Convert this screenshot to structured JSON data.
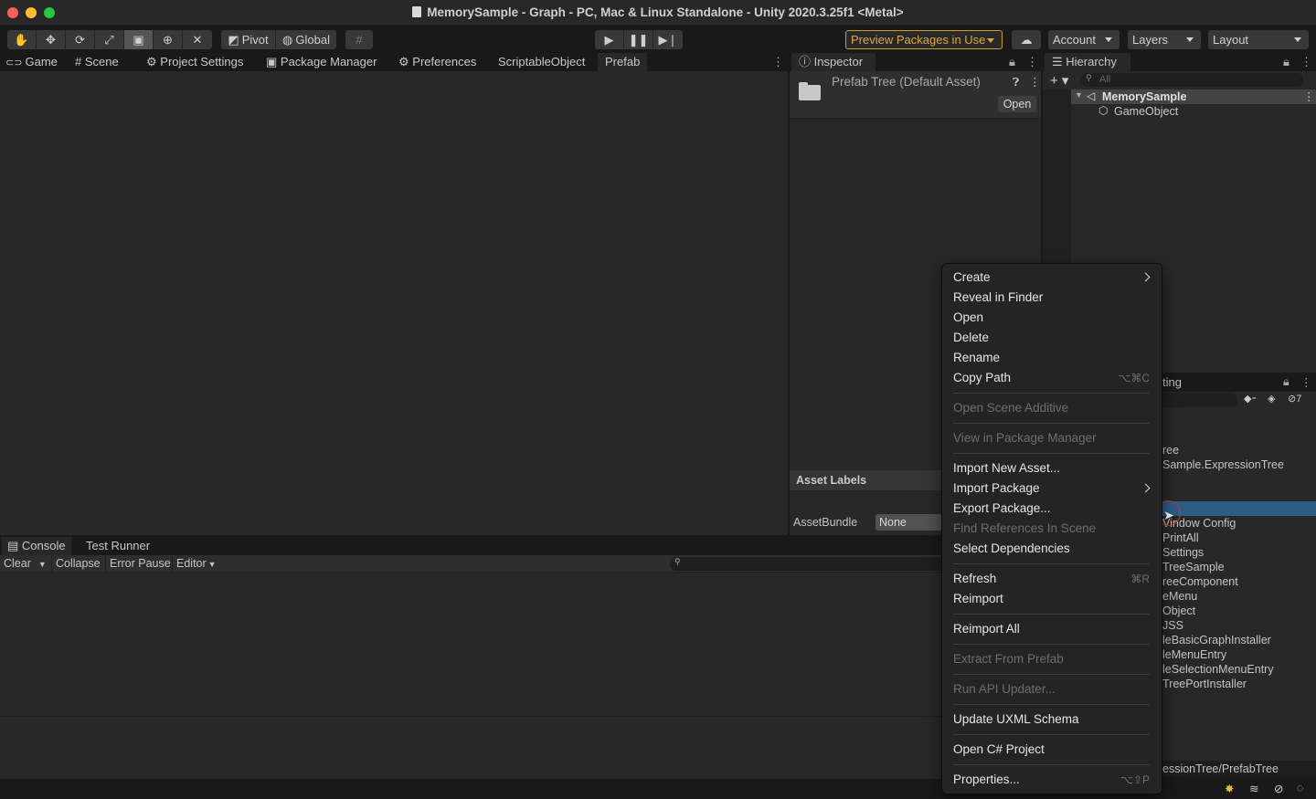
{
  "window": {
    "title": "MemorySample - Graph - PC, Mac & Linux Standalone - Unity 2020.3.25f1 <Metal>"
  },
  "toolbar": {
    "pivot_label": "Pivot",
    "global_label": "Global",
    "preview_packages_label": "Preview Packages in Use",
    "account_label": "Account",
    "layers_label": "Layers",
    "layout_label": "Layout"
  },
  "main_tabs": [
    "Game",
    "Scene",
    "Project Settings",
    "Package Manager",
    "Preferences",
    "ScriptableObject",
    "Prefab"
  ],
  "inspector": {
    "tab_label": "Inspector",
    "asset_title": "Prefab Tree (Default Asset)",
    "open_button": "Open",
    "asset_labels_header": "Asset Labels",
    "assetbundle_label": "AssetBundle",
    "assetbundle_value": "None"
  },
  "hierarchy": {
    "tab_label": "Hierarchy",
    "search_placeholder": "All",
    "scene_name": "MemorySample",
    "child_object": "GameObject"
  },
  "project_panel": {
    "tab_partial": "ting",
    "hidden_count": "7",
    "items": [
      "ree",
      "Sample.ExpressionTree",
      "",
      "Vindow Config",
      "PrintAll",
      "Settings",
      "TreeSample",
      "reeComponent",
      "eMenu",
      "Object",
      "JSS",
      "leBasicGraphInstaller",
      "leMenuEntry",
      "leSelectionMenuEntry",
      "TreePortInstaller"
    ],
    "path": "essionTree/PrefabTree"
  },
  "console": {
    "tabs": [
      "Console",
      "Test Runner"
    ],
    "clear_label": "Clear",
    "collapse_label": "Collapse",
    "error_pause_label": "Error Pause",
    "editor_label": "Editor"
  },
  "context_menu": {
    "create": "Create",
    "reveal_in_finder": "Reveal in Finder",
    "open": "Open",
    "delete": "Delete",
    "rename": "Rename",
    "copy_path": "Copy Path",
    "copy_path_shortcut": "⌥⌘C",
    "open_scene_additive": "Open Scene Additive",
    "view_in_package_manager": "View in Package Manager",
    "import_new_asset": "Import New Asset...",
    "import_package": "Import Package",
    "export_package": "Export Package...",
    "find_references": "Find References In Scene",
    "select_dependencies": "Select Dependencies",
    "refresh": "Refresh",
    "refresh_shortcut": "⌘R",
    "reimport": "Reimport",
    "reimport_all": "Reimport All",
    "extract_from_prefab": "Extract From Prefab",
    "run_api_updater": "Run API Updater...",
    "update_uxml_schema": "Update UXML Schema",
    "open_csharp_project": "Open C# Project",
    "properties": "Properties...",
    "properties_shortcut": "⌥⇧P"
  },
  "colors": {
    "background": "#191919",
    "panel": "#282828",
    "menu_bg": "#242424",
    "selection": "#2c5d87",
    "preview_border": "#c89b2c"
  }
}
